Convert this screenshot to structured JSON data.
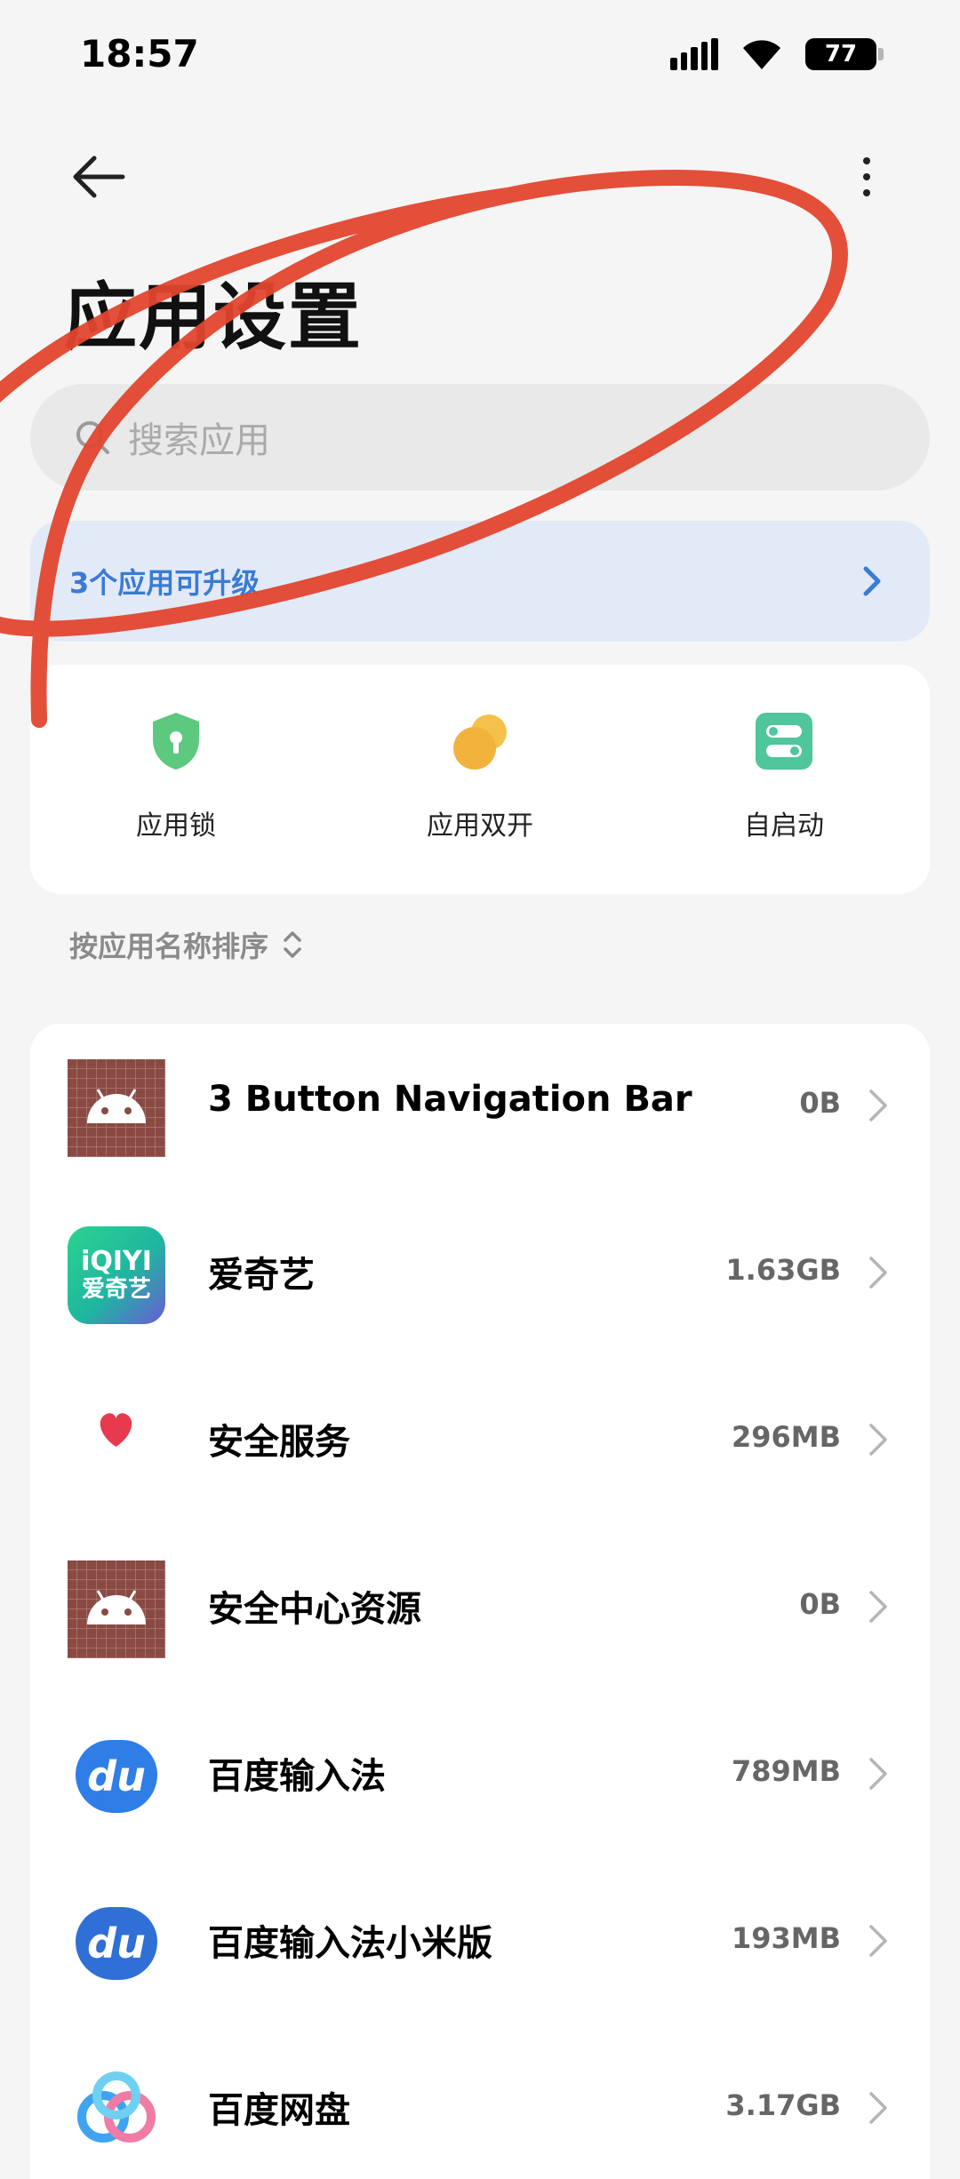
{
  "status_bar": {
    "time": "18:57",
    "battery": "77"
  },
  "header": {
    "title": "应用设置"
  },
  "search": {
    "placeholder": "搜索应用"
  },
  "upgrade_banner": {
    "text": "3个应用可升级"
  },
  "quick_actions": [
    {
      "label": "应用锁",
      "icon": "shield-lock-icon",
      "color": "#5cc97e"
    },
    {
      "label": "应用双开",
      "icon": "dual-circle-icon",
      "color": "#f2b33d"
    },
    {
      "label": "自启动",
      "icon": "toggle-switch-icon",
      "color": "#4fc69b"
    }
  ],
  "sort": {
    "label": "按应用名称排序"
  },
  "apps": [
    {
      "name": "3 Button Navigation Bar",
      "size": "0B",
      "icon": "android-icon"
    },
    {
      "name": "爱奇艺",
      "size": "1.63GB",
      "icon": "iqiyi-icon",
      "icon_text": "iQIYI",
      "icon_subtext": "爱奇艺"
    },
    {
      "name": "安全服务",
      "size": "296MB",
      "icon": "heart-icon"
    },
    {
      "name": "安全中心资源",
      "size": "0B",
      "icon": "android-icon"
    },
    {
      "name": "百度输入法",
      "size": "789MB",
      "icon": "baidu-input-icon",
      "icon_text": "du"
    },
    {
      "name": "百度输入法小米版",
      "size": "193MB",
      "icon": "baidu-input-icon",
      "icon_text": "du"
    },
    {
      "name": "百度网盘",
      "size": "3.17GB",
      "icon": "baidu-netdisk-icon"
    }
  ],
  "colors": {
    "accent_blue": "#3a7bd5",
    "scribble_red": "#e2462e"
  }
}
